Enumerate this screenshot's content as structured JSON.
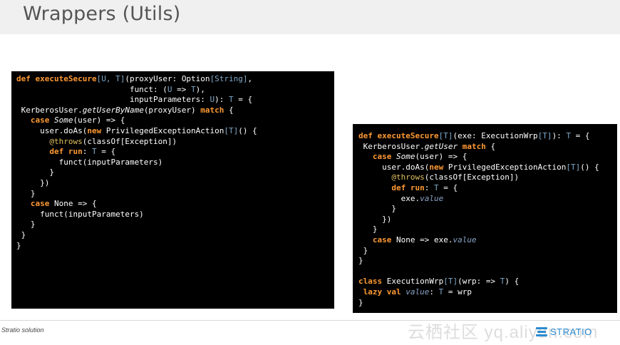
{
  "slide": {
    "title": "Wrappers (Utils)",
    "footer": "Stratio solution",
    "watermark": "云栖社区 yq.aliyun.com",
    "logo_text": "STRATIO"
  },
  "colors": {
    "code_background": "#000000",
    "keyword": "#ff9933",
    "type_param": "#7fa8c8",
    "annotation": "#e0c060",
    "value": "#8aa4c8",
    "logo": "#2a8bd0"
  },
  "code_left": [
    [
      [
        "def ",
        "kw"
      ],
      [
        "executeSecure",
        "kw"
      ],
      [
        "[U, T]",
        "ty"
      ],
      [
        "(proxyUser: Option",
        ""
      ],
      [
        "[String]",
        "ty"
      ],
      [
        ",",
        ""
      ]
    ],
    [
      [
        "                        funct: (",
        ""
      ],
      [
        "U",
        "ty"
      ],
      [
        " => ",
        ""
      ],
      [
        "T",
        "ty"
      ],
      [
        "),",
        ""
      ]
    ],
    [
      [
        "                        inputParameters: ",
        ""
      ],
      [
        "U",
        "ty"
      ],
      [
        "): ",
        ""
      ],
      [
        "T",
        "ty"
      ],
      [
        " = {",
        ""
      ]
    ],
    [
      [
        " KerberosUser.",
        ""
      ],
      [
        "getUserByName",
        "it"
      ],
      [
        "(proxyUser) ",
        ""
      ],
      [
        "match",
        "kw"
      ],
      [
        " {",
        ""
      ]
    ],
    [
      [
        "   ",
        ""
      ],
      [
        "case",
        "kw"
      ],
      [
        " ",
        ""
      ],
      [
        "Some",
        "it"
      ],
      [
        "(user) => {",
        ""
      ]
    ],
    [
      [
        "     user.doAs(",
        ""
      ],
      [
        "new",
        "kw"
      ],
      [
        " PrivilegedExceptionAction",
        ""
      ],
      [
        "[T]",
        "ty"
      ],
      [
        "() {",
        ""
      ]
    ],
    [
      [
        "       ",
        ""
      ],
      [
        "@throws",
        "an"
      ],
      [
        "(classOf[Exception])",
        ""
      ]
    ],
    [
      [
        "       ",
        ""
      ],
      [
        "def",
        "kw"
      ],
      [
        " ",
        ""
      ],
      [
        "run",
        "kw"
      ],
      [
        ": ",
        ""
      ],
      [
        "T",
        "ty"
      ],
      [
        " = {",
        ""
      ]
    ],
    [
      [
        "         funct(inputParameters)",
        ""
      ]
    ],
    [
      [
        "       }",
        ""
      ]
    ],
    [
      [
        "     })",
        ""
      ]
    ],
    [
      [
        "   }",
        ""
      ]
    ],
    [
      [
        "   ",
        ""
      ],
      [
        "case",
        "kw"
      ],
      [
        " None => {",
        ""
      ]
    ],
    [
      [
        "     funct(inputParameters)",
        ""
      ]
    ],
    [
      [
        "   }",
        ""
      ]
    ],
    [
      [
        " }",
        ""
      ]
    ],
    [
      [
        "}",
        ""
      ]
    ]
  ],
  "code_right": [
    [
      [
        "def ",
        "kw"
      ],
      [
        "executeSecure",
        "kw"
      ],
      [
        "[T]",
        "ty"
      ],
      [
        "(exe: ExecutionWrp",
        ""
      ],
      [
        "[T]",
        "ty"
      ],
      [
        "): ",
        ""
      ],
      [
        "T",
        "ty"
      ],
      [
        " = {",
        ""
      ]
    ],
    [
      [
        " KerberosUser.",
        ""
      ],
      [
        "getUser",
        "it"
      ],
      [
        " ",
        ""
      ],
      [
        "match",
        "kw"
      ],
      [
        " {",
        ""
      ]
    ],
    [
      [
        "   ",
        ""
      ],
      [
        "case",
        "kw"
      ],
      [
        " ",
        ""
      ],
      [
        "Some",
        "it"
      ],
      [
        "(user) => {",
        ""
      ]
    ],
    [
      [
        "     user.doAs(",
        ""
      ],
      [
        "new",
        "kw"
      ],
      [
        " PrivilegedExceptionAction",
        ""
      ],
      [
        "[T]",
        "ty"
      ],
      [
        "() {",
        ""
      ]
    ],
    [
      [
        "       ",
        ""
      ],
      [
        "@throws",
        "an"
      ],
      [
        "(classOf[Exception])",
        ""
      ]
    ],
    [
      [
        "       ",
        ""
      ],
      [
        "def",
        "kw"
      ],
      [
        " ",
        ""
      ],
      [
        "run",
        "kw"
      ],
      [
        ": ",
        ""
      ],
      [
        "T",
        "ty"
      ],
      [
        " = {",
        ""
      ]
    ],
    [
      [
        "         exe.",
        ""
      ],
      [
        "value",
        "vl"
      ]
    ],
    [
      [
        "       }",
        ""
      ]
    ],
    [
      [
        "     })",
        ""
      ]
    ],
    [
      [
        "   }",
        ""
      ]
    ],
    [
      [
        "   ",
        ""
      ],
      [
        "case",
        "kw"
      ],
      [
        " None => exe.",
        ""
      ],
      [
        "value",
        "vl"
      ]
    ],
    [
      [
        " }",
        ""
      ]
    ],
    [
      [
        "}",
        ""
      ]
    ],
    [
      [
        "",
        ""
      ]
    ],
    [
      [
        "class",
        "kw"
      ],
      [
        " ExecutionWrp",
        ""
      ],
      [
        "[T]",
        "ty"
      ],
      [
        "(wrp: => ",
        ""
      ],
      [
        "T",
        "ty"
      ],
      [
        ") {",
        ""
      ]
    ],
    [
      [
        " ",
        ""
      ],
      [
        "lazy",
        "kw"
      ],
      [
        " ",
        ""
      ],
      [
        "val",
        "kw"
      ],
      [
        " ",
        ""
      ],
      [
        "value",
        "vl"
      ],
      [
        ": ",
        ""
      ],
      [
        "T",
        "ty"
      ],
      [
        " = wrp",
        ""
      ]
    ],
    [
      [
        "}",
        ""
      ]
    ]
  ]
}
